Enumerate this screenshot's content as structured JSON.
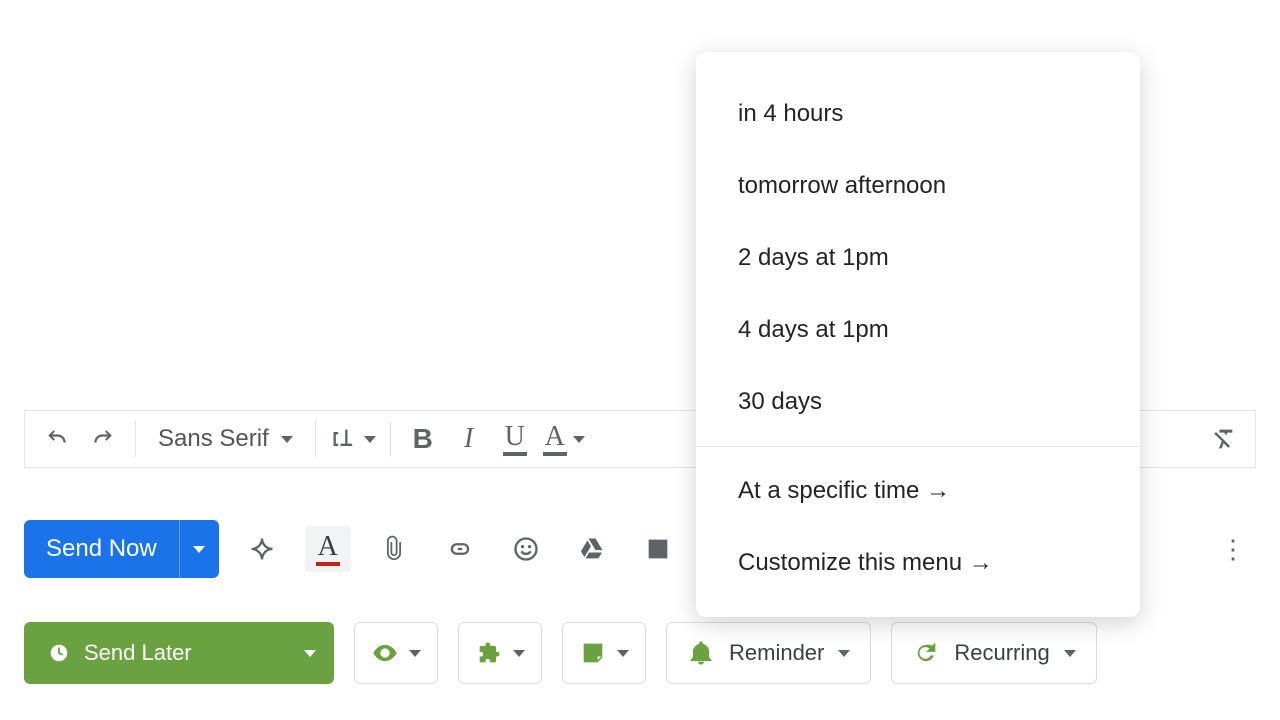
{
  "toolbar": {
    "font_family": "Sans Serif"
  },
  "send": {
    "now_label": "Send Now",
    "later_label": "Send Later",
    "reminder_label": "Reminder",
    "recurring_label": "Recurring"
  },
  "schedule_menu": {
    "items": [
      "in 4 hours",
      "tomorrow afternoon",
      "2 days at 1pm",
      "4 days at 1pm",
      "30 days"
    ],
    "specific_time": "At a specific time",
    "customize": "Customize this menu"
  }
}
